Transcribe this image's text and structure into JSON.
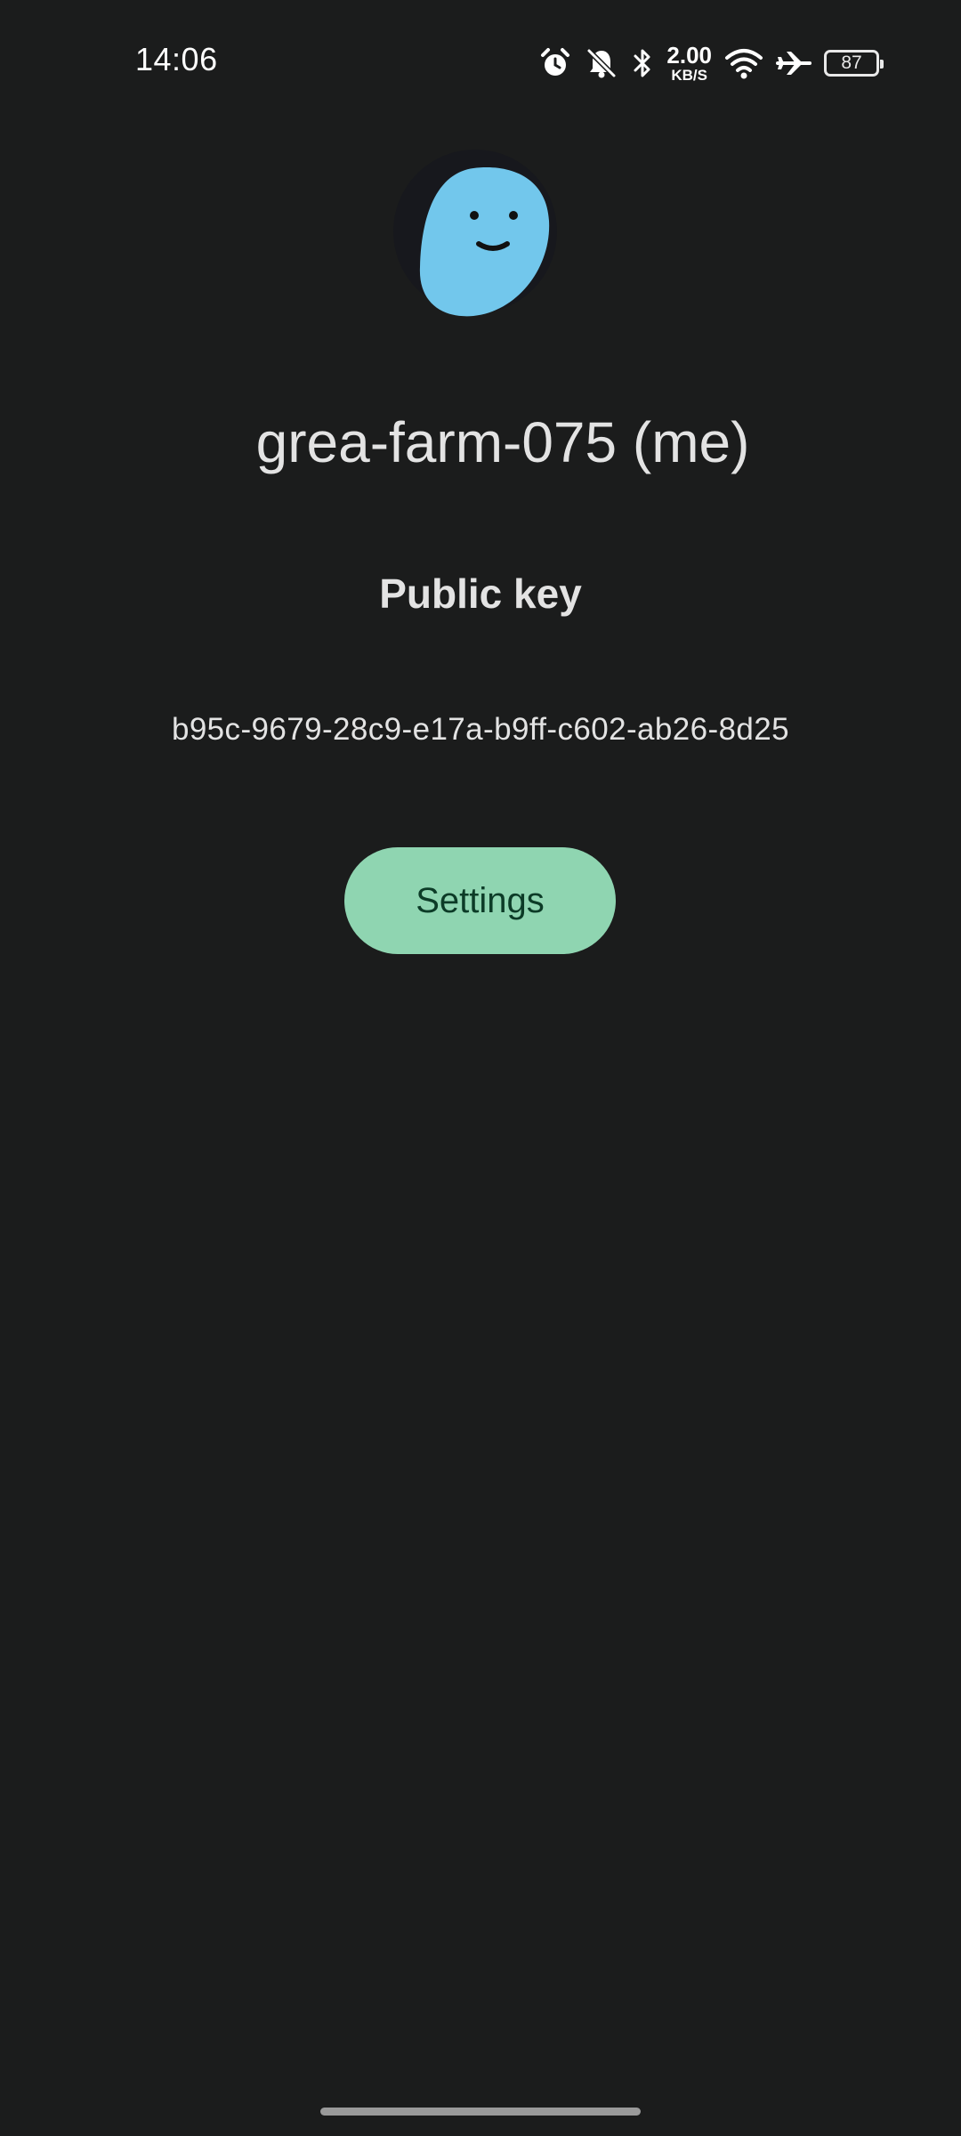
{
  "status_bar": {
    "time": "14:06",
    "net_speed_value": "2.00",
    "net_speed_unit": "KB/S",
    "battery_level": "87",
    "icons": [
      "alarm-icon",
      "bell-off-icon",
      "bluetooth-icon",
      "network-speed",
      "wifi-icon",
      "airplane-icon",
      "battery-icon"
    ]
  },
  "profile": {
    "avatar_icon": "smiley-face-avatar",
    "avatar_color": "#72c7ec",
    "name": "grea-farm-075 (me)",
    "public_key_label": "Public key",
    "public_key_value": "b95c-9679-28c9-e17a-b9ff-c602-ab26-8d25"
  },
  "actions": {
    "settings_label": "Settings",
    "settings_color": "#8fd5b1"
  },
  "colors": {
    "background": "#1b1c1c",
    "text": "#e3e3e3"
  }
}
